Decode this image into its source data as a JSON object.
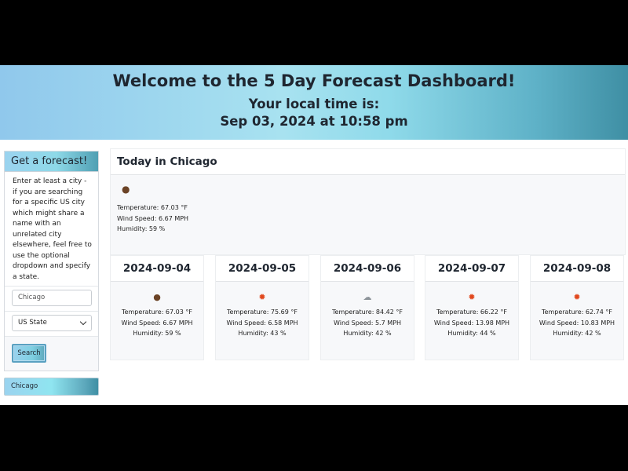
{
  "header": {
    "title": "Welcome to the 5 Day Forecast Dashboard!",
    "subtitle": "Your local time is:",
    "local_time": "Sep 03, 2024 at 10:58 pm"
  },
  "sidebar": {
    "card_title": "Get a forecast!",
    "help_text": "Enter at least a city - if you are searching for a specific US city which might share a name with an unrelated city elsewhere, feel free to use the optional dropdown and specify a state.",
    "city_input": {
      "value": "",
      "placeholder": "Chicago"
    },
    "state_select": {
      "selected": "US State"
    },
    "search_label": "Search",
    "history": [
      "Chicago"
    ]
  },
  "today": {
    "heading": "Today in Chicago",
    "icon": "night-icon",
    "icon_glyph": "●",
    "temperature": "Temperature: 67.03 °F",
    "wind": "Wind Speed: 6.67 MPH",
    "humidity": "Humidity: 59 %"
  },
  "forecast": [
    {
      "date": "2024-09-04",
      "icon": "night-icon",
      "icon_glyph": "●",
      "temperature": "Temperature: 67.03 °F",
      "wind": "Wind Speed: 6.67 MPH",
      "humidity": "Humidity: 59 %"
    },
    {
      "date": "2024-09-05",
      "icon": "sun-icon",
      "icon_glyph": "✹",
      "temperature": "Temperature: 75.69 °F",
      "wind": "Wind Speed: 6.58 MPH",
      "humidity": "Humidity: 43 %"
    },
    {
      "date": "2024-09-06",
      "icon": "cloud-icon",
      "icon_glyph": "☁",
      "temperature": "Temperature: 84.42 °F",
      "wind": "Wind Speed: 5.7 MPH",
      "humidity": "Humidity: 42 %"
    },
    {
      "date": "2024-09-07",
      "icon": "sun-icon",
      "icon_glyph": "✹",
      "temperature": "Temperature: 66.22 °F",
      "wind": "Wind Speed: 13.98 MPH",
      "humidity": "Humidity: 44 %"
    },
    {
      "date": "2024-09-08",
      "icon": "sun-icon",
      "icon_glyph": "✹",
      "temperature": "Temperature: 62.74 °F",
      "wind": "Wind Speed: 10.83 MPH",
      "humidity": "Humidity: 42 %"
    }
  ],
  "colors": {
    "header_gradient_start": "#90c8ec",
    "header_gradient_end": "#3f8fa4",
    "sun": "#e1471c",
    "moon": "#6b4326",
    "cloud": "#8d949a"
  }
}
